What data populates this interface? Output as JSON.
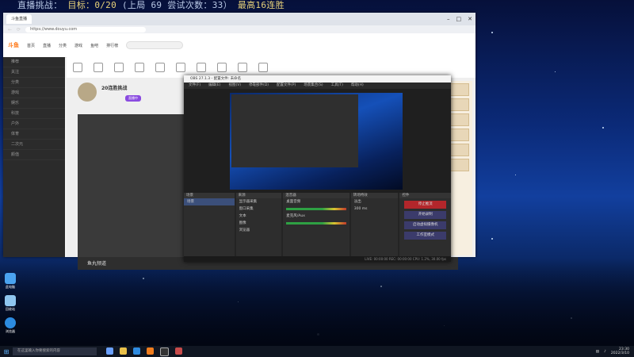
{
  "overlay": {
    "prefix": "直播挑战：",
    "goal_text": "目标：0/20",
    "last_text": "(上局",
    "last_value": "69",
    "tries_text": "尝试次数：33）",
    "best_text": "最高16连胜"
  },
  "browser": {
    "tab_title": "斗鱼直播",
    "url": "https://www.douyu.com",
    "brand": "斗鱼",
    "nav": [
      "首页",
      "直播",
      "分类",
      "游戏",
      "鱼吧",
      "排行榜"
    ],
    "sidebar": [
      "推荐",
      "关注",
      "分类",
      "游戏",
      "娱乐",
      "科技",
      "户外",
      "体育",
      "二次元",
      "颜值"
    ],
    "streamer_name": "20连胜挑战",
    "badge": "直播中",
    "bottom_label": "鱼丸频道"
  },
  "obs": {
    "title": "OBS 27.1.3 - 配置文件: 未命名",
    "menu": [
      "文件(F)",
      "编辑(E)",
      "视图(V)",
      "停靠部件(D)",
      "配置文件(P)",
      "场景集合(S)",
      "工具(T)",
      "帮助(H)"
    ],
    "dock_scenes": "场景",
    "dock_sources": "来源",
    "dock_mixer": "混音器",
    "dock_transitions": "转场特效",
    "dock_controls": "控件",
    "scenes": [
      "场景"
    ],
    "sources": [
      "显示器采集",
      "窗口采集",
      "文本",
      "图像",
      "浏览器"
    ],
    "mixer": [
      "桌面音频",
      "麦克风/Aux"
    ],
    "transition": "淡出",
    "duration": "300 ms",
    "controls": [
      "停止推流",
      "开始录制",
      "启动虚拟摄像机",
      "工作室模式",
      "设置",
      "退出"
    ],
    "status": "LIVE: 00:00:00  REC: 00:00:00  CPU: 1.2%, 30.00 fps"
  },
  "desktop": {
    "icons": [
      "此电脑",
      "回收站",
      "浏览器"
    ]
  },
  "taskbar": {
    "search_placeholder": "在这里输入你要搜索的内容",
    "time": "23:30",
    "date": "2022/3/10"
  }
}
